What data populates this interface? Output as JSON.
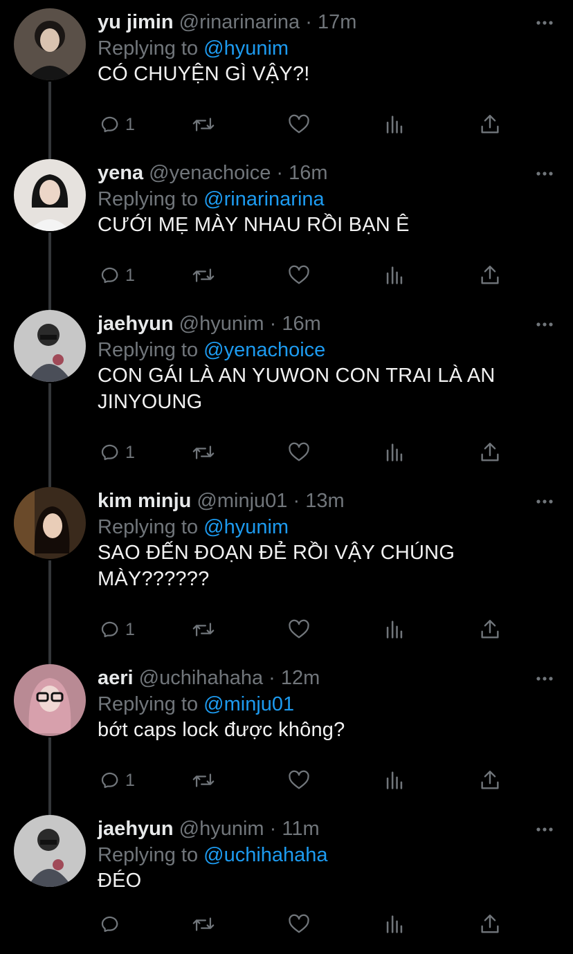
{
  "tweets": [
    {
      "name": "yu jimin",
      "handle": "@rinarinarina",
      "time": "17m",
      "replying_label": "Replying to",
      "replying_to": "@hyunim",
      "text": "CÓ CHUYỆN GÌ VẬY?!",
      "reply_count": "1",
      "avatar_color": "#5a5048",
      "hair_color": "#1a1614"
    },
    {
      "name": "yena",
      "handle": "@yenachoice",
      "time": "16m",
      "replying_label": "Replying to",
      "replying_to": "@rinarinarina",
      "text": "CƯỚI MẸ MÀY NHAU RỒI BẠN Ê",
      "reply_count": "1",
      "avatar_color": "#e6e2de",
      "hair_color": "#141414"
    },
    {
      "name": "jaehyun",
      "handle": "@hyunim",
      "time": "16m",
      "replying_label": "Replying to",
      "replying_to": "@yenachoice",
      "text": "CON GÁI LÀ AN YUWON CON TRAI LÀ AN JINYOUNG",
      "reply_count": "1",
      "avatar_color": "#c7c7c7",
      "hair_color": "#2a2a2a"
    },
    {
      "name": "kim minju",
      "handle": "@minju01",
      "time": "13m",
      "replying_label": "Replying to",
      "replying_to": "@hyunim",
      "text": "SAO ĐẾN ĐOẠN ĐẺ RỒI VẬY CHÚNG MÀY??????",
      "reply_count": "1",
      "avatar_color": "#3a2a1c",
      "hair_color": "#140c08"
    },
    {
      "name": "aeri",
      "handle": "@uchihahaha",
      "time": "12m",
      "replying_label": "Replying to",
      "replying_to": "@minju01",
      "text": "bớt caps lock được không?",
      "reply_count": "1",
      "avatar_color": "#b98a94",
      "hair_color": "#d7a0ac"
    },
    {
      "name": "jaehyun",
      "handle": "@hyunim",
      "time": "11m",
      "replying_label": "Replying to",
      "replying_to": "@uchihahaha",
      "text": "ĐÉO",
      "reply_count": "",
      "avatar_color": "#c7c7c7",
      "hair_color": "#2a2a2a"
    }
  ],
  "separator": "·",
  "icons": {
    "reply": "reply-icon",
    "retweet": "retweet-icon",
    "like": "heart-icon",
    "analytics": "analytics-icon",
    "share": "share-icon",
    "more": "more-icon"
  },
  "colors": {
    "background": "#000000",
    "text": "#e7e9ea",
    "secondary": "#71767b",
    "accent": "#1d9bf0",
    "thread_line": "#333639"
  }
}
